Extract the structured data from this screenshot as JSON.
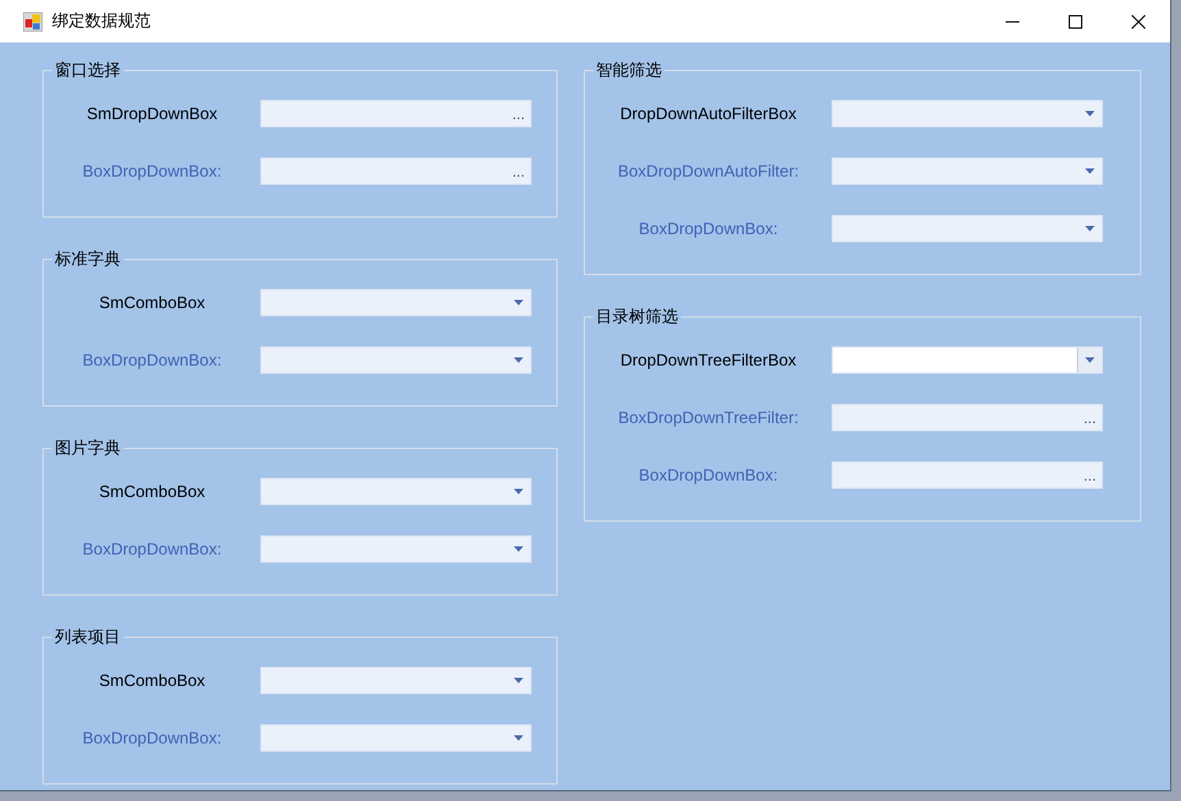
{
  "window": {
    "title": "绑定数据规范"
  },
  "columns": [
    {
      "groups": [
        {
          "title": "窗口选择",
          "rows": [
            {
              "label": "SmDropDownBox",
              "kind": "primary",
              "button": {
                "kind": "ellipsis",
                "text": "..."
              },
              "focused": false
            },
            {
              "label": "BoxDropDownBox:",
              "kind": "secondary",
              "button": {
                "kind": "ellipsis",
                "text": "..."
              },
              "focused": false
            }
          ]
        },
        {
          "title": "标准字典",
          "rows": [
            {
              "label": "SmComboBox",
              "kind": "primary",
              "button": {
                "kind": "dropdown"
              },
              "focused": false
            },
            {
              "label": "BoxDropDownBox:",
              "kind": "secondary",
              "button": {
                "kind": "dropdown"
              },
              "focused": false
            }
          ]
        },
        {
          "title": "图片字典",
          "rows": [
            {
              "label": "SmComboBox",
              "kind": "primary",
              "button": {
                "kind": "dropdown"
              },
              "focused": false
            },
            {
              "label": "BoxDropDownBox:",
              "kind": "secondary",
              "button": {
                "kind": "dropdown"
              },
              "focused": false
            }
          ]
        },
        {
          "title": "列表项目",
          "rows": [
            {
              "label": "SmComboBox",
              "kind": "primary",
              "button": {
                "kind": "dropdown"
              },
              "focused": false
            },
            {
              "label": "BoxDropDownBox:",
              "kind": "secondary",
              "button": {
                "kind": "dropdown"
              },
              "focused": false
            }
          ]
        }
      ]
    },
    {
      "groups": [
        {
          "title": "智能筛选",
          "rows": [
            {
              "label": "DropDownAutoFilterBox",
              "kind": "primary",
              "button": {
                "kind": "dropdown"
              },
              "focused": false
            },
            {
              "label": "BoxDropDownAutoFilter:",
              "kind": "secondary",
              "button": {
                "kind": "dropdown"
              },
              "focused": false
            },
            {
              "label": "BoxDropDownBox:",
              "kind": "secondary",
              "button": {
                "kind": "dropdown"
              },
              "focused": false
            }
          ]
        },
        {
          "title": "目录树筛选",
          "rows": [
            {
              "label": "DropDownTreeFilterBox",
              "kind": "primary",
              "button": {
                "kind": "dropdown"
              },
              "focused": true
            },
            {
              "label": "BoxDropDownTreeFilter:",
              "kind": "secondary",
              "button": {
                "kind": "ellipsis",
                "text": "..."
              },
              "focused": false
            },
            {
              "label": "BoxDropDownBox:",
              "kind": "secondary",
              "button": {
                "kind": "ellipsis",
                "text": "..."
              },
              "focused": false
            }
          ]
        }
      ]
    }
  ]
}
